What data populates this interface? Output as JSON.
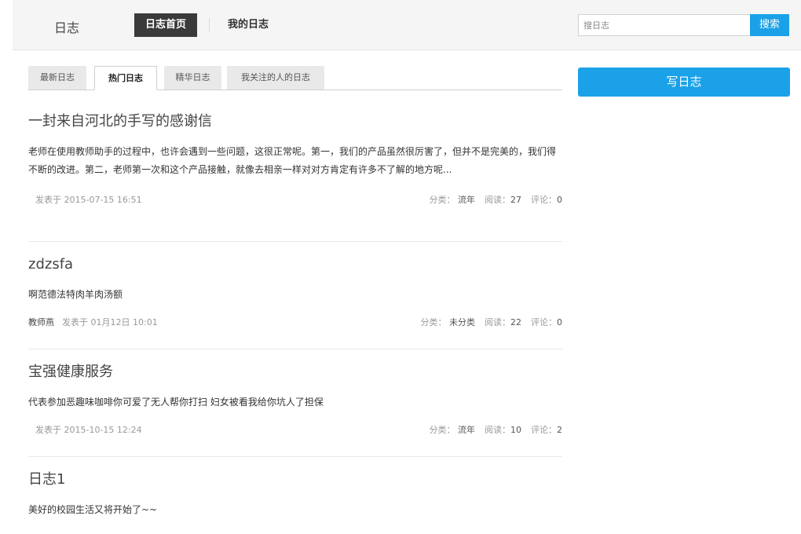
{
  "header": {
    "brand": "日志",
    "nav": {
      "home": "日志首页",
      "mine": "我的日志"
    },
    "search": {
      "placeholder": "搜日志",
      "button": "搜索"
    }
  },
  "tabs": [
    "最新日志",
    "热门日志",
    "精华日志",
    "我关注的人的日志"
  ],
  "active_tab": "热门日志",
  "write_button": "写日志",
  "labels": {
    "posted": "发表于",
    "category": "分类：",
    "reads": "阅读：",
    "comments": "评论："
  },
  "posts": [
    {
      "title": "一封来自河北的手写的感谢信",
      "excerpt": "老师在使用教师助手的过程中，也许会遇到一些问题，这很正常呢。第一，我们的产品虽然很厉害了，但并不是完美的，我们得不断的改进。第二，老师第一次和这个产品接触，就像去相亲一样对对方肯定有许多不了解的地方呢...",
      "author": "",
      "date": "2015-07-15 16:51",
      "category": "流年",
      "reads": "27",
      "comments": "0"
    },
    {
      "title": "zdzsfa",
      "excerpt": "啊范德法特肉羊肉汤额",
      "author": "教师燕",
      "date": "01月12日 10:01",
      "category": "未分类",
      "reads": "22",
      "comments": "0"
    },
    {
      "title": "宝强健康服务",
      "excerpt": "代表参加恶趣味咖啡你可爱了无人帮你打扫 妇女被看我给你坑人了担保",
      "author": "",
      "date": "2015-10-15 12:24",
      "category": "流年",
      "reads": "10",
      "comments": "2"
    },
    {
      "title": "日志1",
      "excerpt": "美好的校园生活又将开始了~~"
    }
  ],
  "colors": {
    "accent": "#1ba1e8",
    "nav_active_bg": "#3a3a3a",
    "header_bg": "#f5f5f5"
  }
}
